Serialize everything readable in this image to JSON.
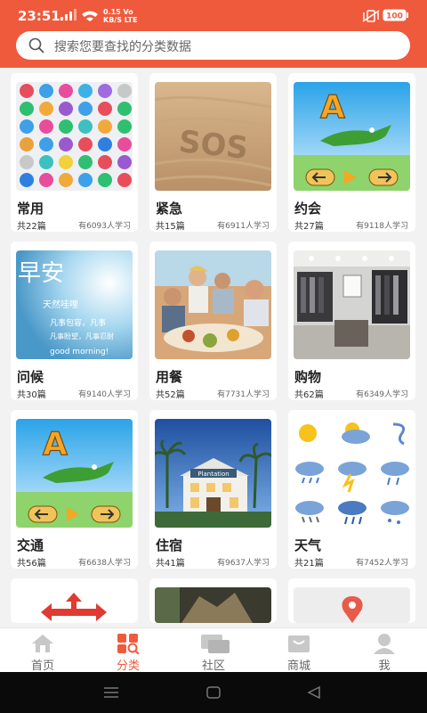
{
  "status_bar": {
    "time": "23:51",
    "speed_top": "0.15 Vo",
    "speed_bottom": "KB/S LTE",
    "battery": "100"
  },
  "search": {
    "placeholder": "搜索您要查找的分类数据"
  },
  "categories": [
    {
      "title": "常用",
      "count": "共22篇",
      "learners": "有6093人学习"
    },
    {
      "title": "紧急",
      "count": "共15篇",
      "learners": "有6911人学习"
    },
    {
      "title": "约会",
      "count": "共27篇",
      "learners": "有9118人学习"
    },
    {
      "title": "问候",
      "count": "共30篇",
      "learners": "有9140人学习"
    },
    {
      "title": "用餐",
      "count": "共52篇",
      "learners": "有7731人学习"
    },
    {
      "title": "购物",
      "count": "共62篇",
      "learners": "有6349人学习"
    },
    {
      "title": "交通",
      "count": "共56篇",
      "learners": "有6638人学习"
    },
    {
      "title": "住宿",
      "count": "共41篇",
      "learners": "有9637人学习"
    },
    {
      "title": "天气",
      "count": "共21篇",
      "learners": "有7452人学习"
    }
  ],
  "thumb_text": {
    "sos": "SOS",
    "letter_a": "A",
    "greeting_big": "早安",
    "greeting_line1": "天然哇哩",
    "greeting_line2": "凡事包容，凡事",
    "greeting_line3": "凡事盼望，凡事忍耐",
    "greeting_line4": "good morning!",
    "hotel_sign": "Plantation"
  },
  "tabbar": [
    {
      "label": "首页",
      "icon": "home-icon"
    },
    {
      "label": "分类",
      "icon": "category-icon"
    },
    {
      "label": "社区",
      "icon": "community-icon"
    },
    {
      "label": "商城",
      "icon": "mall-icon"
    },
    {
      "label": "我",
      "icon": "profile-icon"
    }
  ],
  "colors": {
    "brand": "#ef5a3c",
    "tab_inactive": "#c8c8c8"
  }
}
